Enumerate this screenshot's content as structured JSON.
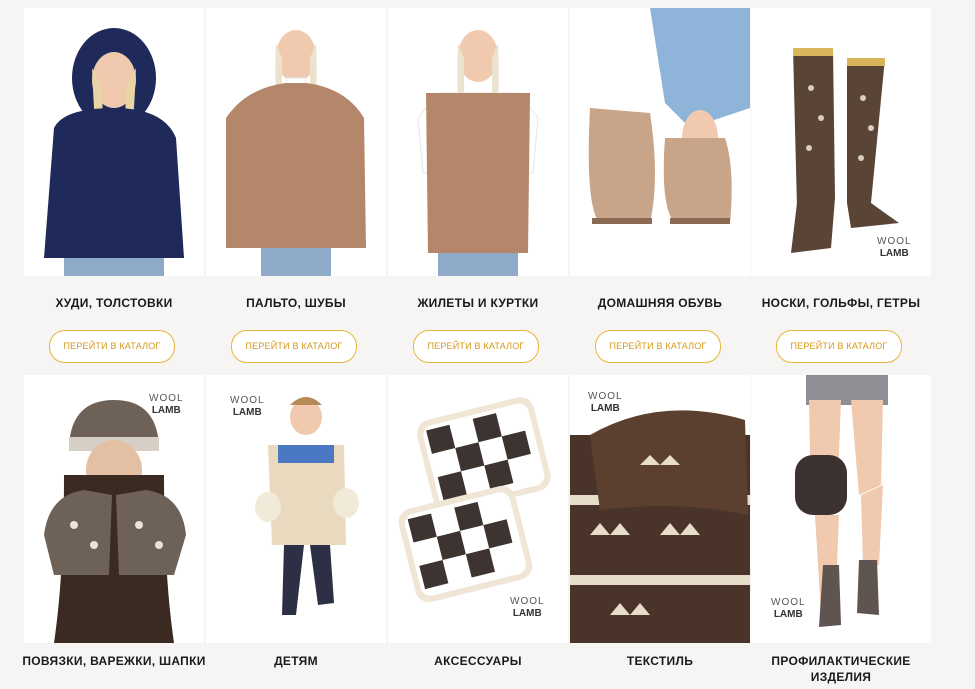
{
  "catalog": {
    "button_label": "ПЕРЕЙТИ В КАТАЛОГ",
    "logo": {
      "line1": "WOOL",
      "line2": "LAMB"
    },
    "accent_color": "#e8b53a",
    "row1": [
      {
        "title": "ХУДИ, ТОЛСТОВКИ"
      },
      {
        "title": "ПАЛЬТО, ШУБЫ"
      },
      {
        "title": "ЖИЛЕТЫ И КУРТКИ"
      },
      {
        "title": "ДОМАШНЯЯ ОБУВЬ"
      },
      {
        "title": "НОСКИ, ГОЛЬФЫ, ГЕТРЫ"
      }
    ],
    "row2": [
      {
        "title": "ПОВЯЗКИ, ВАРЕЖКИ, ШАПКИ"
      },
      {
        "title": "ДЕТЯМ"
      },
      {
        "title": "АКСЕССУАРЫ"
      },
      {
        "title": "ТЕКСТИЛЬ"
      },
      {
        "title": "ПРОФИЛАКТИЧЕСКИЕ ИЗДЕЛИЯ"
      }
    ]
  }
}
